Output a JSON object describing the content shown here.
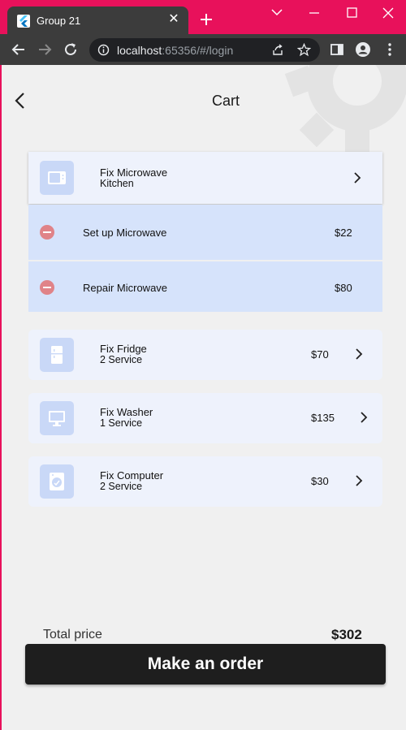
{
  "browser": {
    "tab_title": "Group 21",
    "tab_close": "✕",
    "url_host": "localhost",
    "url_rest": ":65356/#/login"
  },
  "page": {
    "title": "Cart"
  },
  "cart": {
    "expanded_item": {
      "title": "Fix Microwave",
      "subtitle": "Kitchen",
      "icon": "microwave-icon",
      "services": [
        {
          "name": "Set up Microwave",
          "price": "$22"
        },
        {
          "name": "Repair Microwave",
          "price": "$80"
        }
      ]
    },
    "items": [
      {
        "title": "Fix Fridge",
        "subtitle": "2 Service",
        "price": "$70",
        "icon": "fridge-icon"
      },
      {
        "title": "Fix Washer",
        "subtitle": "1 Service",
        "price": "$135",
        "icon": "monitor-icon"
      },
      {
        "title": "Fix Computer",
        "subtitle": "2 Service",
        "price": "$30",
        "icon": "washer-icon"
      }
    ]
  },
  "footer": {
    "total_label": "Total price",
    "total_value": "$302",
    "order_button": "Make an order"
  },
  "colors": {
    "browser_accent": "#e8115b",
    "card_bg": "#eef2fc",
    "service_row_bg": "#d6e3fb",
    "remove_icon": "#e08388",
    "button_bg": "#1e1e1e"
  }
}
